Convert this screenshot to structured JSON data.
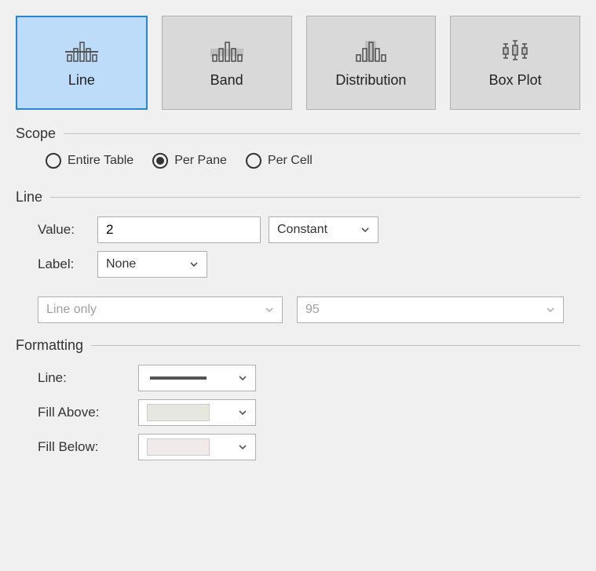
{
  "tabs": {
    "line": {
      "label": "Line",
      "selected": true
    },
    "band": {
      "label": "Band",
      "selected": false
    },
    "distribution": {
      "label": "Distribution",
      "selected": false
    },
    "boxplot": {
      "label": "Box Plot",
      "selected": false
    }
  },
  "sections": {
    "scope": "Scope",
    "line": "Line",
    "formatting": "Formatting"
  },
  "scope": {
    "entire_table": "Entire Table",
    "per_pane": "Per Pane",
    "per_cell": "Per Cell",
    "selected": "per_pane"
  },
  "line_section": {
    "value_label": "Value:",
    "value_input": "2",
    "value_type": "Constant",
    "label_label": "Label:",
    "label_select": "None",
    "fill_mode": "Line only",
    "confidence": "95"
  },
  "formatting": {
    "line_label": "Line:",
    "fill_above_label": "Fill Above:",
    "fill_below_label": "Fill Below:",
    "fill_above_color": "#e6e7df",
    "fill_below_color": "#f1eaea",
    "line_sample_color": "#555555"
  }
}
